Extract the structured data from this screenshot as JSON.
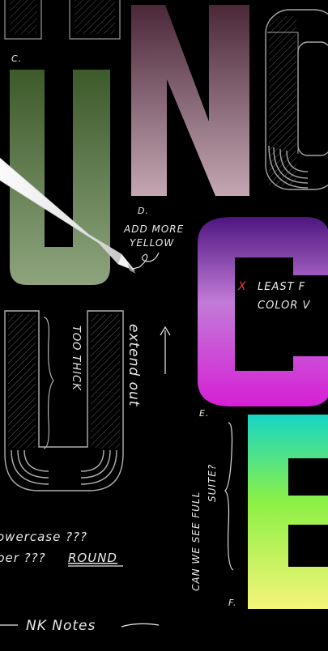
{
  "notes": {
    "label_c": "C.",
    "label_d": "D.",
    "add_more": "ADD MORE",
    "yellow": "YELLOW",
    "least_prefix": "X",
    "least_line1": "LEAST F",
    "least_line2": "COLOR V",
    "too_thick": "TOO THICK",
    "extend_out": "extend out",
    "label_e": "E.",
    "can_we_see": "CAN WE SEE FULL",
    "suite": "SUITE?",
    "lowercase": "owercase ???",
    "per_round": "per ??? ",
    "round": "ROUND",
    "label_f": "F.",
    "nk_notes": "NK Notes"
  },
  "colors": {
    "background": "#000000",
    "letter_u_green": "#6f8a5f",
    "letter_n_top": "#5b3242",
    "letter_n_bottom": "#b79aa6",
    "letter_c_top": "#5a1a8e",
    "letter_c_bottom": "#d126d4",
    "letter_e_top": "#1ee0c0",
    "letter_e_bottom": "#f4f76a",
    "chalk": "#dcdcdc",
    "red_x": "#e03a3a"
  },
  "icons": {
    "pencil": "apple-pencil-icon"
  }
}
